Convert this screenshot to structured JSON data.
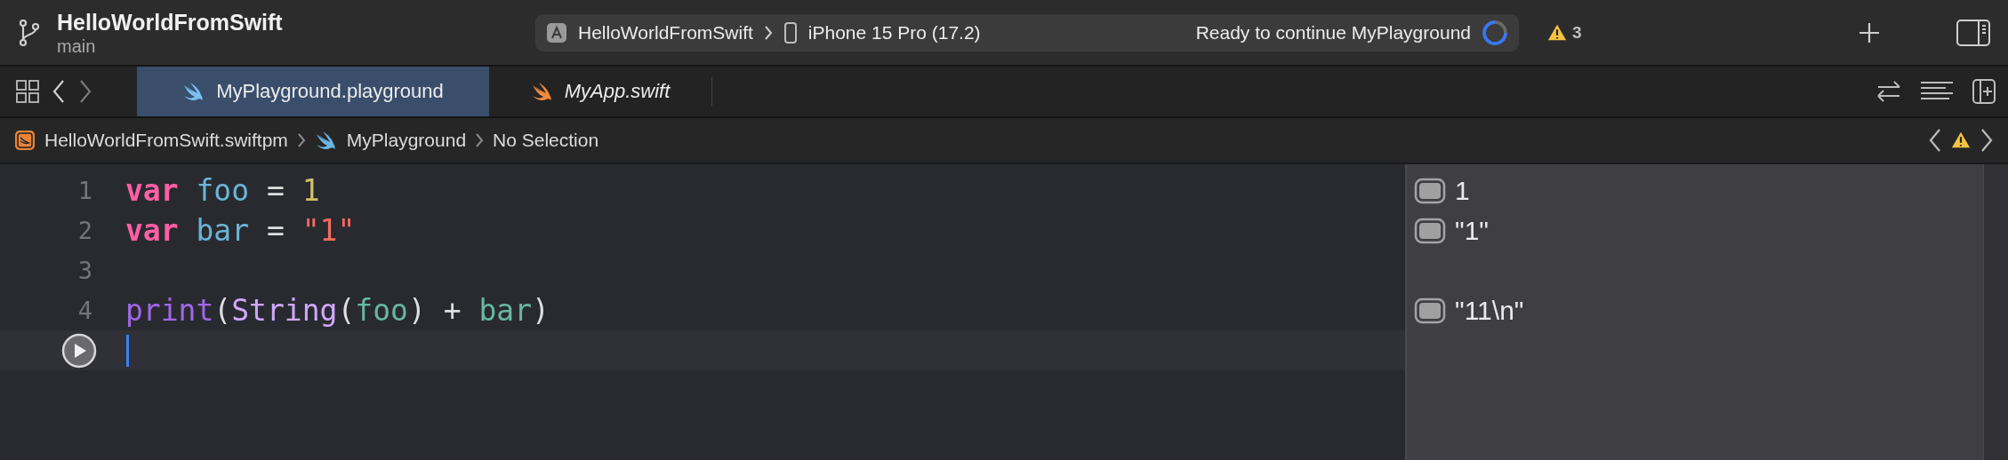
{
  "toolbar": {
    "project": "HelloWorldFromSwift",
    "branch": "main",
    "scheme": "HelloWorldFromSwift",
    "device": "iPhone 15 Pro (17.2)",
    "status": "Ready to continue MyPlayground",
    "warning_count": "3"
  },
  "tabs": [
    {
      "label": "MyPlayground.playground",
      "selected": true,
      "kind": "playground"
    },
    {
      "label": "MyApp.swift",
      "selected": false,
      "kind": "swift"
    }
  ],
  "breadcrumb": [
    {
      "label": "HelloWorldFromSwift.swiftpm",
      "kind": "package"
    },
    {
      "label": "MyPlayground",
      "kind": "playground"
    },
    {
      "label": "No Selection",
      "kind": "plain"
    }
  ],
  "editor": {
    "lines": [
      {
        "number": "1",
        "tokens": [
          {
            "text": "var ",
            "kind": "keyword"
          },
          {
            "text": "foo",
            "kind": "declaration"
          },
          {
            "text": " = ",
            "kind": "plain"
          },
          {
            "text": "1",
            "kind": "number"
          }
        ],
        "result": "1"
      },
      {
        "number": "2",
        "tokens": [
          {
            "text": "var ",
            "kind": "keyword"
          },
          {
            "text": "bar",
            "kind": "declaration"
          },
          {
            "text": " = ",
            "kind": "plain"
          },
          {
            "text": "\"1\"",
            "kind": "string"
          }
        ],
        "result": "\"1\""
      },
      {
        "number": "3"
      },
      {
        "number": "4",
        "tokens": [
          {
            "text": "print",
            "kind": "function"
          },
          {
            "text": "(",
            "kind": "plain"
          },
          {
            "text": "String",
            "kind": "type"
          },
          {
            "text": "(",
            "kind": "plain"
          },
          {
            "text": "foo",
            "kind": "reference"
          },
          {
            "text": ") + ",
            "kind": "plain"
          },
          {
            "text": "bar",
            "kind": "reference"
          },
          {
            "text": ")",
            "kind": "plain"
          }
        ],
        "result": "\"11\\n\""
      }
    ]
  }
}
